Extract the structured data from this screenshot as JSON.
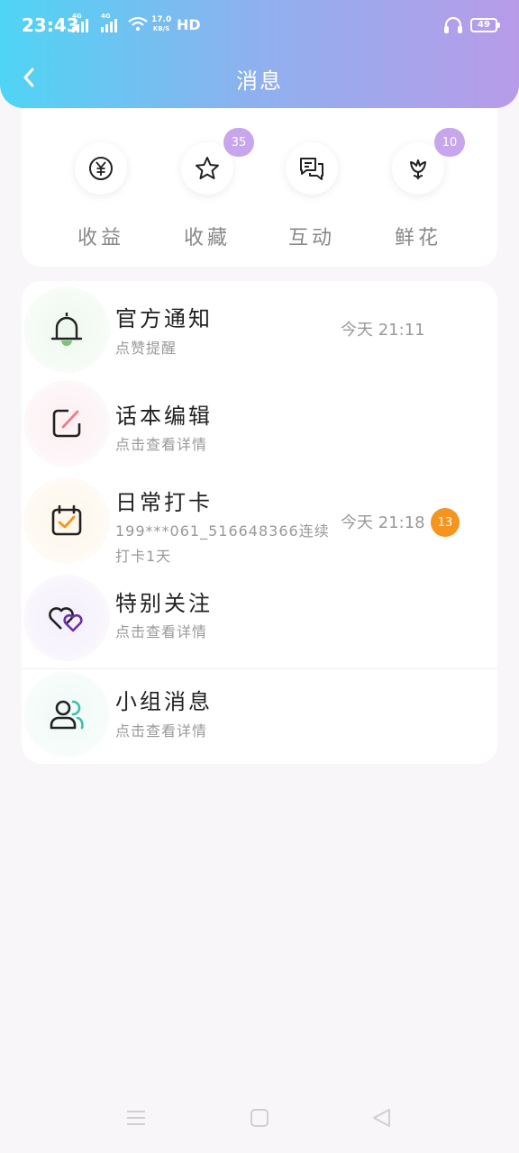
{
  "status_bar": {
    "time": "23:43",
    "net1": "4G",
    "net2": "4G",
    "speed_value": "17.0",
    "speed_unit": "KB/S",
    "hd": "HD",
    "battery": "49"
  },
  "header": {
    "title": "消息",
    "back_icon": "chevron-left-icon"
  },
  "quick_actions": [
    {
      "label": "收益",
      "icon": "yuan-icon",
      "badge": ""
    },
    {
      "label": "收藏",
      "icon": "star-icon",
      "badge": "35"
    },
    {
      "label": "互动",
      "icon": "chat-icon",
      "badge": ""
    },
    {
      "label": "鲜花",
      "icon": "flower-icon",
      "badge": "10"
    }
  ],
  "messages": [
    {
      "title": "官方通知",
      "subtitle": "点赞提醒",
      "time": "今天 21:11",
      "badge": "",
      "icon": "bell-icon"
    },
    {
      "title": "话本编辑",
      "subtitle": "点击查看详情",
      "time": "",
      "badge": "",
      "icon": "edit-icon"
    },
    {
      "title": "日常打卡",
      "subtitle": "199***061_516648366连续打卡1天",
      "time": "今天 21:18",
      "badge": "13",
      "icon": "calendar-check-icon"
    },
    {
      "title": "特别关注",
      "subtitle": "点击查看详情",
      "time": "",
      "badge": "",
      "icon": "hearts-icon"
    },
    {
      "title": "小组消息",
      "subtitle": "点击查看详情",
      "time": "",
      "badge": "",
      "icon": "group-icon"
    }
  ],
  "colors": {
    "header_gradient_start": "#4fd4f4",
    "header_gradient_end": "#b89be8",
    "quick_badge": "#c8a6ec",
    "msg_badge": "#f5951f"
  },
  "system_nav": [
    "menu-icon",
    "home-icon",
    "back-triangle-icon"
  ]
}
